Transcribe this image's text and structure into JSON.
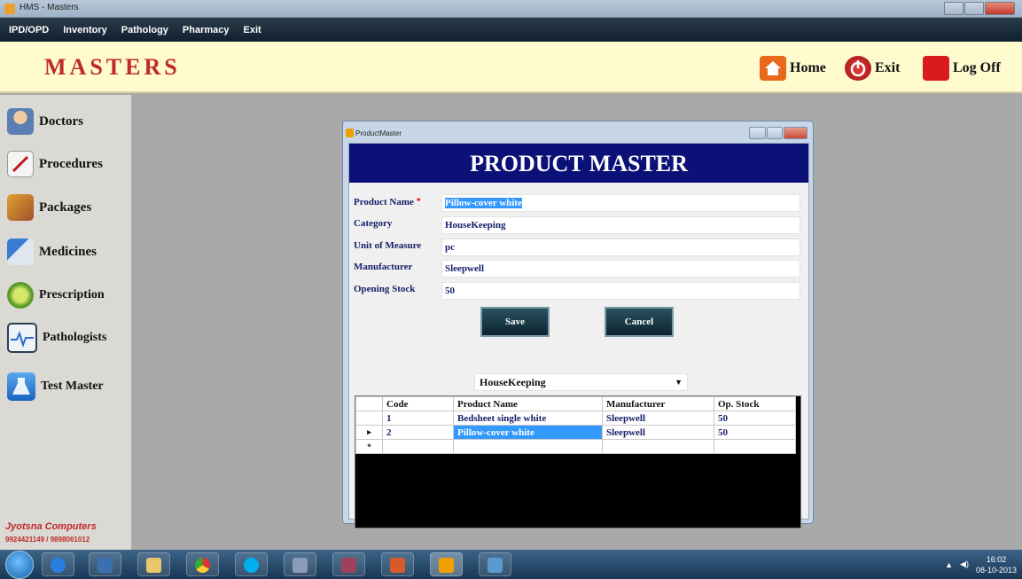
{
  "window": {
    "title": "HMS - Masters"
  },
  "menu": [
    "IPD/OPD",
    "Inventory",
    "Pathology",
    "Pharmacy",
    "Exit"
  ],
  "header": {
    "brand": "MASTERS",
    "home_label": "Home",
    "exit_label": "Exit",
    "logoff_label": "Log Off"
  },
  "sidebar": {
    "items": [
      {
        "label": "Doctors",
        "icon": "doctor-icon"
      },
      {
        "label": "Procedures",
        "icon": "scalpel-icon"
      },
      {
        "label": "Packages",
        "icon": "box-icon"
      },
      {
        "label": "Medicines",
        "icon": "syringe-icon"
      },
      {
        "label": "Prescription",
        "icon": "prescription-icon"
      },
      {
        "label": "Pathologists",
        "icon": "monitor-pulse-icon"
      },
      {
        "label": "Test Master",
        "icon": "flask-icon"
      }
    ],
    "footer_company": "Jyotsna Computers",
    "footer_phone": "9924421149 / 9898061012"
  },
  "dialog": {
    "title": "ProductMaster",
    "banner": "PRODUCT MASTER",
    "fields": {
      "product_name": {
        "label": "Product Name",
        "value": "Pillow-cover white",
        "required": "*"
      },
      "category": {
        "label": "Category",
        "value": "HouseKeeping"
      },
      "unit": {
        "label": "Unit of Measure",
        "value": "pc"
      },
      "manufacturer": {
        "label": "Manufacturer",
        "value": "Sleepwell"
      },
      "opening_stock": {
        "label": "Opening Stock",
        "value": "50"
      }
    },
    "save_label": "Save",
    "cancel_label": "Cancel",
    "filter_value": "HouseKeeping",
    "grid": {
      "columns": [
        "Code",
        "Product Name",
        "Manufacturer",
        "Op. Stock"
      ],
      "rows": [
        {
          "marker": "",
          "code": "1",
          "name": "Bedsheet single white",
          "manufacturer": "Sleepwell",
          "stock": "50"
        },
        {
          "marker": "▸",
          "code": "2",
          "name": "Pillow-cover white",
          "manufacturer": "Sleepwell",
          "stock": "50"
        }
      ],
      "new_row_marker": "*"
    }
  },
  "taskbar": {
    "clock_time": "16:02",
    "clock_date": "08-10-2013"
  },
  "colors": {
    "banner": "#0c1177",
    "brand": "#c0292b",
    "header_bg": "#fffbcf",
    "selection": "#3399ff"
  }
}
